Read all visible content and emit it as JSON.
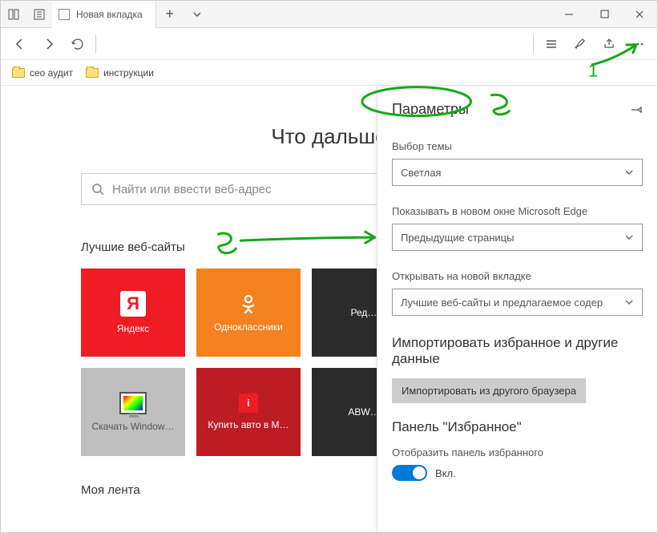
{
  "window": {
    "tab_title": "Новая вкладка"
  },
  "favorites_bar": {
    "items": [
      {
        "label": "сео аудит"
      },
      {
        "label": "инструкции"
      }
    ]
  },
  "startpage": {
    "heading": "Что дальше",
    "search_placeholder": "Найти или ввести веб-адрес",
    "top_sites_label": "Лучшие веб-сайты",
    "feed_label": "Моя лента",
    "tiles": [
      {
        "label": "Яндекс",
        "style": "red",
        "icon": "ya"
      },
      {
        "label": "Одноклассники",
        "style": "orange",
        "icon": "ok"
      },
      {
        "label": "Ред…",
        "style": "dark",
        "icon": "none"
      },
      {
        "label": "Скачать Window…",
        "style": "gray",
        "icon": "monitor"
      },
      {
        "label": "Купить авто в М…",
        "style": "crimson",
        "icon": "redbox"
      },
      {
        "label": "ABW…",
        "style": "dark",
        "icon": "none"
      }
    ]
  },
  "settings_panel": {
    "title": "Параметры",
    "theme_label": "Выбор темы",
    "theme_value": "Светлая",
    "open_with_label": "Показывать в новом окне Microsoft Edge",
    "open_with_value": "Предыдущие страницы",
    "newtab_label": "Открывать на новой вкладке",
    "newtab_value": "Лучшие веб-сайты и предлагаемое содер",
    "import_heading": "Импортировать избранное и другие данные",
    "import_button": "Импортировать из другого браузера",
    "favorites_heading": "Панель \"Избранное\"",
    "show_favbar_label": "Отобразить панель избранного",
    "toggle_state": "Вкл."
  },
  "annotations": {
    "n1": "1",
    "n2": "2",
    "n3": "3"
  }
}
